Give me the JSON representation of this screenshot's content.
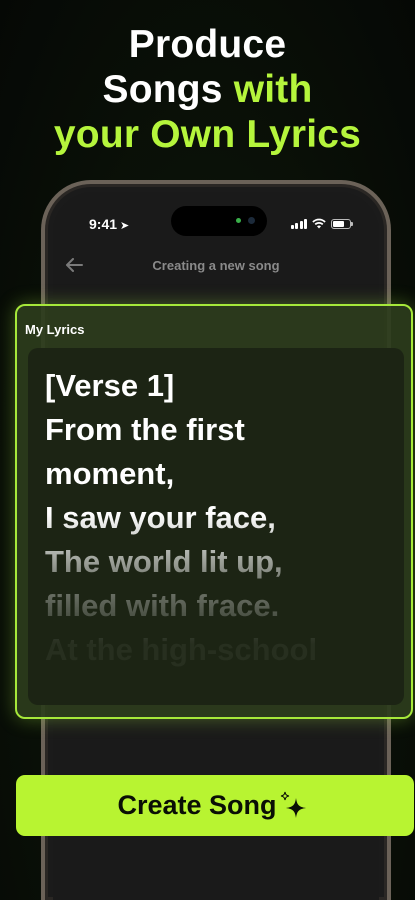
{
  "headline": {
    "line1": "Produce",
    "line2_white": "Songs",
    "line2_green": "with",
    "line3": "your Own Lyrics"
  },
  "status_bar": {
    "time": "9:41"
  },
  "screen": {
    "title": "Creating a new song"
  },
  "lyrics": {
    "label": "My Lyrics",
    "lines": [
      "[Verse 1]",
      "From the first",
      "moment,",
      "I saw your face,",
      "The world lit up,",
      "filled with frace.",
      "At the high-school"
    ]
  },
  "create_button": {
    "label": "Create Song"
  },
  "colors": {
    "accent": "#b5f53c",
    "button": "#b8f431",
    "background": "#0b1208"
  }
}
